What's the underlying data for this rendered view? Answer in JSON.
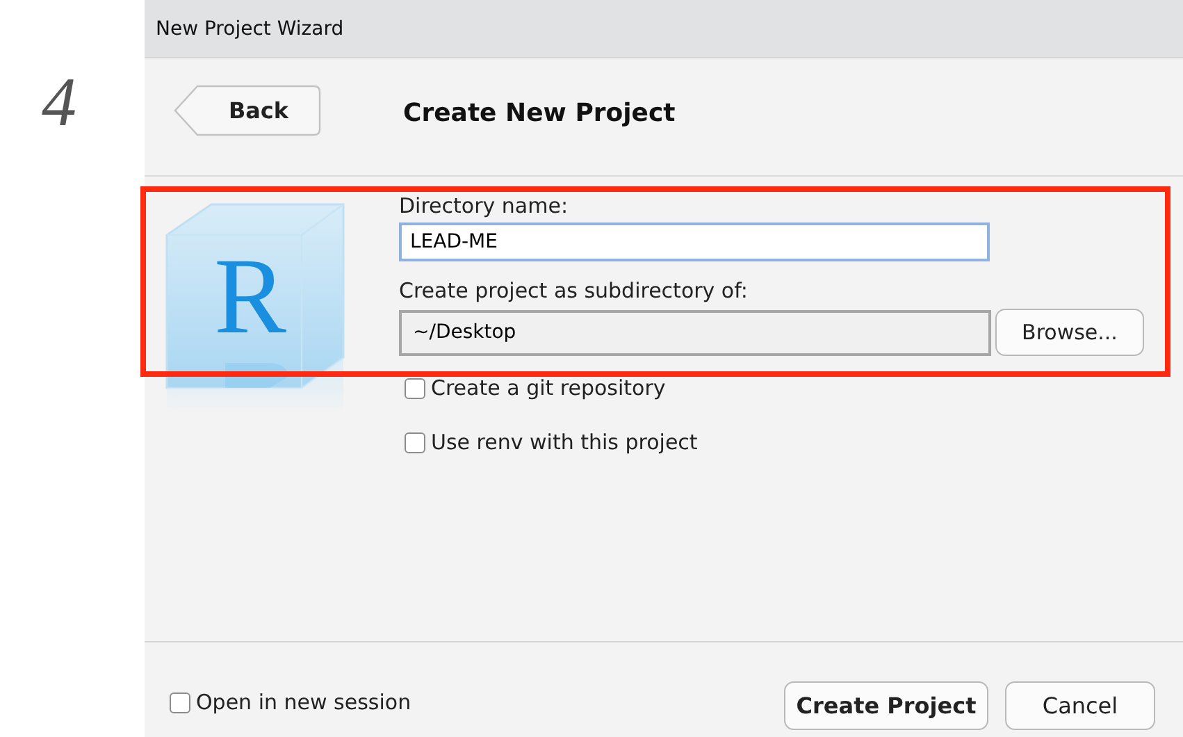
{
  "step_number": "4",
  "window": {
    "title": "New Project Wizard"
  },
  "back_button": "Back",
  "heading": "Create New Project",
  "logo_letter": "R",
  "directory_name": {
    "label": "Directory name:",
    "value": "LEAD-ME",
    "focused": true
  },
  "parent_directory": {
    "label": "Create project as subdirectory of:",
    "value": "~/Desktop"
  },
  "browse_button": "Browse...",
  "options": [
    {
      "label": "Create a git repository",
      "checked": false
    },
    {
      "label": "Use renv with this project",
      "checked": false
    }
  ],
  "open_in_new_session": {
    "label": "Open in new session",
    "checked": false
  },
  "buttons": [
    "Create Project",
    "Cancel"
  ]
}
